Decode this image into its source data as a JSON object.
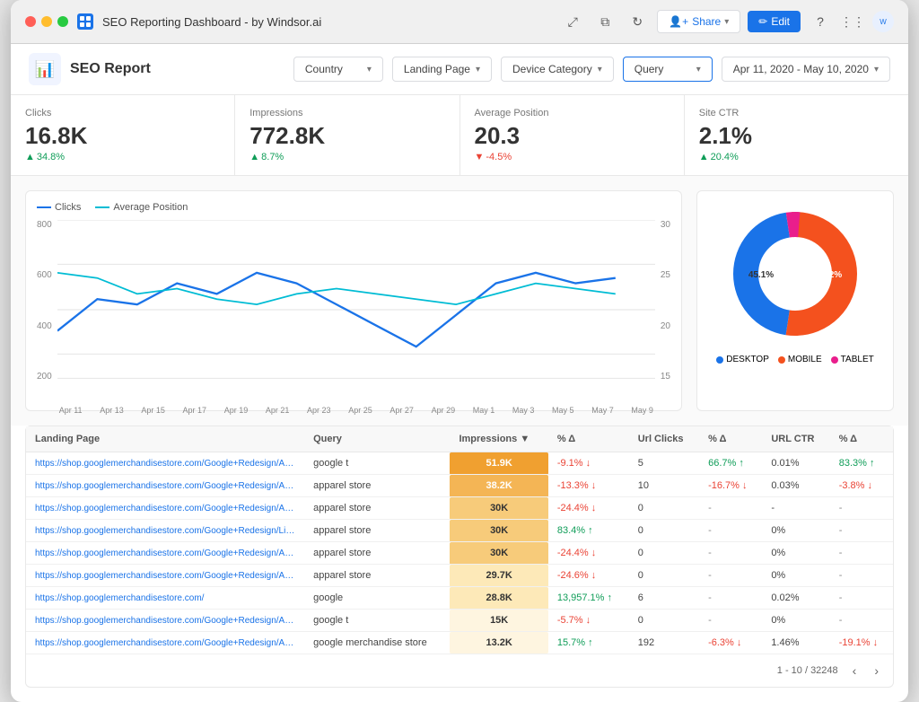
{
  "titlebar": {
    "title": "SEO Reporting Dashboard - by Windsor.ai",
    "share_label": "Share",
    "edit_label": "Edit",
    "user_initials": "windsor.ai"
  },
  "report": {
    "title": "SEO Report",
    "logo_icon": "📊"
  },
  "filters": [
    {
      "id": "country",
      "label": "Country"
    },
    {
      "id": "landing_page",
      "label": "Landing Page"
    },
    {
      "id": "device_category",
      "label": "Device Category"
    },
    {
      "id": "query",
      "label": "Query"
    }
  ],
  "date_range": "Apr 11, 2020 - May 10, 2020",
  "kpis": [
    {
      "label": "Clicks",
      "value": "16.8K",
      "change": "34.8%",
      "direction": "up"
    },
    {
      "label": "Impressions",
      "value": "772.8K",
      "change": "8.7%",
      "direction": "up"
    },
    {
      "label": "Average Position",
      "value": "20.3",
      "change": "-4.5%",
      "direction": "down"
    },
    {
      "label": "Site CTR",
      "value": "2.1%",
      "change": "20.4%",
      "direction": "up"
    }
  ],
  "chart": {
    "legend": [
      {
        "label": "Clicks",
        "color": "#1a73e8"
      },
      {
        "label": "Average Position",
        "color": "#00bcd4"
      }
    ],
    "y_labels": [
      "800",
      "600",
      "400",
      "200"
    ],
    "y2_labels": [
      "30",
      "25",
      "20",
      "15"
    ],
    "x_labels": [
      "Apr 11",
      "Apr 13",
      "Apr 15",
      "Apr 17",
      "Apr 19",
      "Apr 21",
      "Apr 23",
      "Apr 25",
      "Apr 27",
      "Apr 29",
      "May 1",
      "May 3",
      "May 5",
      "May 7",
      "May 9"
    ]
  },
  "donut": {
    "segments": [
      {
        "label": "DESKTOP",
        "value": 45.1,
        "color": "#1a73e8"
      },
      {
        "label": "MOBILE",
        "value": 52.2,
        "color": "#f4511e"
      },
      {
        "label": "TABLET",
        "value": 2.7,
        "color": "#e91e8c"
      }
    ]
  },
  "table": {
    "headers": [
      "Landing Page",
      "Query",
      "Impressions ▼",
      "% Δ",
      "Url Clicks",
      "% Δ",
      "URL CTR",
      "% Δ"
    ],
    "rows": [
      {
        "landing_page": "https://shop.googlemerchandisestore.com/Google+Redesign/Apparel/Mens/Mens+T-Shirts",
        "query": "google t",
        "impressions": "51.9K",
        "imp_pct": "-9.1% ↓",
        "url_clicks": "5",
        "clicks_pct": "66.7% ↑",
        "url_ctr": "0.01%",
        "ctr_pct": "83.3% ↑",
        "imp_class": "imp-high"
      },
      {
        "landing_page": "https://shop.googlemerchandisestore.com/Google+Redesign/Apparel",
        "query": "apparel store",
        "impressions": "38.2K",
        "imp_pct": "-13.3% ↓",
        "url_clicks": "10",
        "clicks_pct": "-16.7% ↓",
        "url_ctr": "0.03%",
        "ctr_pct": "-3.8% ↓",
        "imp_class": "imp-med-high"
      },
      {
        "landing_page": "https://shop.googlemerchandisestore.com/Google+Redesign/Apparel/Mens",
        "query": "apparel store",
        "impressions": "30K",
        "imp_pct": "-24.4% ↓",
        "url_clicks": "0",
        "clicks_pct": "-",
        "url_ctr": "-",
        "ctr_pct": "-",
        "imp_class": "imp-med"
      },
      {
        "landing_page": "https://shop.googlemerchandisestore.com/Google+Redesign/Lifestyle",
        "query": "apparel store",
        "impressions": "30K",
        "imp_pct": "83.4% ↑",
        "url_clicks": "0",
        "clicks_pct": "-",
        "url_ctr": "0%",
        "ctr_pct": "-",
        "imp_class": "imp-med"
      },
      {
        "landing_page": "https://shop.googlemerchandisestore.com/Google+Redesign/Apparel/Womens",
        "query": "apparel store",
        "impressions": "30K",
        "imp_pct": "-24.4% ↓",
        "url_clicks": "0",
        "clicks_pct": "-",
        "url_ctr": "0%",
        "ctr_pct": "-",
        "imp_class": "imp-med"
      },
      {
        "landing_page": "https://shop.googlemerchandisestore.com/Google+Redesign/Apparel/Socks",
        "query": "apparel store",
        "impressions": "29.7K",
        "imp_pct": "-24.6% ↓",
        "url_clicks": "0",
        "clicks_pct": "-",
        "url_ctr": "0%",
        "ctr_pct": "-",
        "imp_class": "imp-low"
      },
      {
        "landing_page": "https://shop.googlemerchandisestore.com/",
        "query": "google",
        "impressions": "28.8K",
        "imp_pct": "13,957.1% ↑",
        "url_clicks": "6",
        "clicks_pct": "-",
        "url_ctr": "0.02%",
        "ctr_pct": "-",
        "imp_class": "imp-low"
      },
      {
        "landing_page": "https://shop.googlemerchandisestore.com/Google+Redesign/Apparel/Womens/Womens+T-Shirts",
        "query": "google t",
        "impressions": "15K",
        "imp_pct": "-5.7% ↓",
        "url_clicks": "0",
        "clicks_pct": "-",
        "url_ctr": "0%",
        "ctr_pct": "-",
        "imp_class": "imp-lowest"
      },
      {
        "landing_page": "https://shop.googlemerchandisestore.com/Google+Redesign/Apparel",
        "query": "google merchandise store",
        "impressions": "13.2K",
        "imp_pct": "15.7% ↑",
        "url_clicks": "192",
        "clicks_pct": "-6.3% ↓",
        "url_ctr": "1.46%",
        "ctr_pct": "-19.1% ↓",
        "imp_class": "imp-lowest"
      }
    ],
    "pagination": "1 - 10 / 32248"
  }
}
